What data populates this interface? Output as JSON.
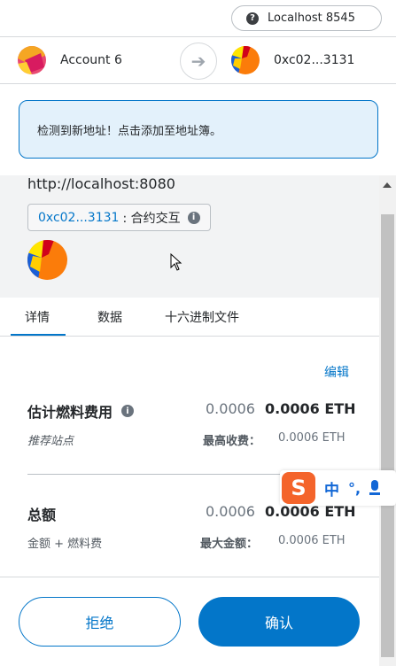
{
  "network": {
    "label": "Localhost 8545",
    "icon": "question-icon"
  },
  "accounts": {
    "from_name": "Account 6",
    "to_address": "0xc02...3131",
    "arrow_icon": "arrow-right-icon"
  },
  "toast": {
    "message": "检测到新地址！点击添加至地址簿。"
  },
  "origin": {
    "url": "http://localhost:8080",
    "contract_address": "0xc02...3131",
    "contract_action": ": 合约交互"
  },
  "tabs": [
    {
      "label": "详情",
      "active": true
    },
    {
      "label": "数据",
      "active": false
    },
    {
      "label": "十六进制文件",
      "active": false
    }
  ],
  "edit_label": "编辑",
  "gas": {
    "label": "估计燃料费用",
    "fiat_value": "0.0006",
    "eth_value": "0.0006 ETH",
    "sub_label": "推荐站点",
    "max_fee_label": "最高收费：",
    "max_fee_value": "0.0006 ETH"
  },
  "total": {
    "label": "总额",
    "fiat_value": "0.0006",
    "eth_value": "0.0006 ETH",
    "sub_label": "金额 + 燃料费",
    "max_amount_label": "最大金额：",
    "max_amount_value": "0.0006 ETH"
  },
  "ime": {
    "logo": "S",
    "lang": "中",
    "punct": "°,"
  },
  "buttons": {
    "reject": "拒绝",
    "confirm": "确认"
  },
  "colors": {
    "accent": "#0376c9",
    "toast_bg": "#e3f1fb",
    "panel_bg": "#f2f3f4"
  }
}
